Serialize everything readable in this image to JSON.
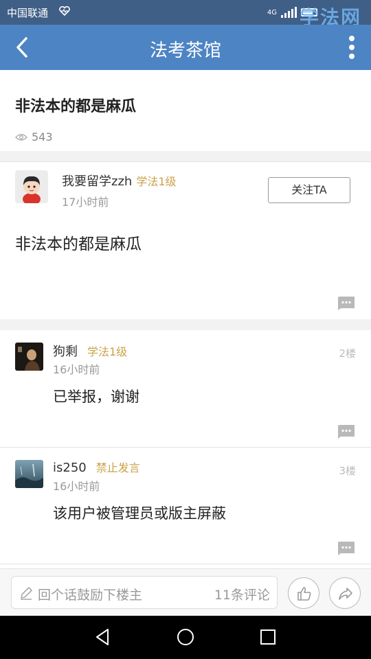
{
  "status_bar": {
    "carrier": "中国联通",
    "network": "4G",
    "watermark": "学法网"
  },
  "nav": {
    "title": "法考茶馆",
    "back_icon": "chevron-left-icon",
    "more_icon": "more-vertical-icon"
  },
  "post": {
    "title": "非法本的都是麻瓜",
    "views": "543",
    "author": {
      "name": "我要留学zzh",
      "level": "学法1级",
      "time": "17小时前",
      "follow_label": "关注TA"
    },
    "body": "非法本的都是麻瓜"
  },
  "replies": [
    {
      "name": "狗剩",
      "level": "学法1级",
      "time": "16小时前",
      "floor": "2楼",
      "body": "已举报，谢谢"
    },
    {
      "name": "is250",
      "level": "禁止发言",
      "time": "16小时前",
      "floor": "3楼",
      "body": "该用户被管理员或版主屏蔽"
    }
  ],
  "bottom_bar": {
    "placeholder": "回个话鼓励下楼主",
    "comment_count": "11条评论"
  },
  "colors": {
    "nav_bg": "#4d84c3",
    "status_bg": "#3f5f86",
    "level_color": "#c9a24a"
  }
}
